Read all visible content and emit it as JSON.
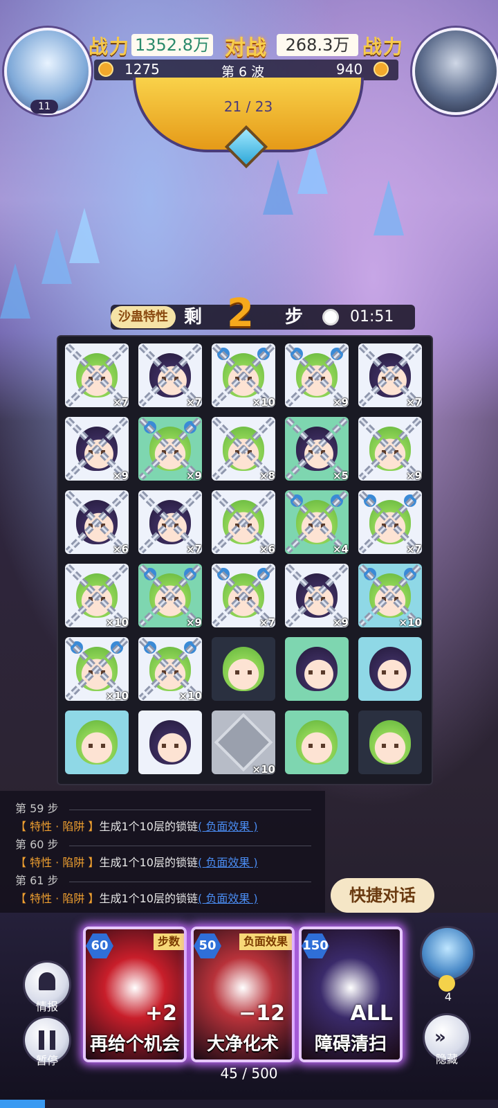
{
  "header": {
    "left_power_label": "战力",
    "left_power": "1352.8万",
    "vs_label": "对战",
    "right_power": "268.3万",
    "right_power_label": "战力",
    "left_score": "1275",
    "wave": "第 6 波",
    "right_score": "940",
    "left_level": "11",
    "wave_progress": "21 / 23"
  },
  "status": {
    "trait_label": "沙蛊特性",
    "steps_prefix": "剩",
    "steps_left": "2",
    "steps_suffix": "步",
    "timer": "01:51"
  },
  "board": {
    "rows": [
      [
        {
          "face": "green",
          "bg": "white",
          "chain": "×7"
        },
        {
          "face": "purple",
          "bg": "white",
          "chain": "×7"
        },
        {
          "face": "blue",
          "bg": "white",
          "chain": "×10"
        },
        {
          "face": "blue",
          "bg": "white",
          "chain": "×9"
        },
        {
          "face": "purple",
          "bg": "white",
          "chain": "×7"
        }
      ],
      [
        {
          "face": "purple",
          "bg": "white",
          "chain": "×9"
        },
        {
          "face": "blue",
          "bg": "green",
          "chain": "×9"
        },
        {
          "face": "green",
          "bg": "white",
          "chain": "×8"
        },
        {
          "face": "purple",
          "bg": "green",
          "chain": "×5"
        },
        {
          "face": "green",
          "bg": "white",
          "chain": "×9"
        }
      ],
      [
        {
          "face": "purple",
          "bg": "white",
          "chain": "×6"
        },
        {
          "face": "purple",
          "bg": "white",
          "chain": "×7"
        },
        {
          "face": "green",
          "bg": "white",
          "chain": "×6"
        },
        {
          "face": "blue",
          "bg": "green",
          "chain": "×4"
        },
        {
          "face": "blue",
          "bg": "white",
          "chain": "×7"
        }
      ],
      [
        {
          "face": "green",
          "bg": "white",
          "chain": "×10"
        },
        {
          "face": "blue",
          "bg": "green",
          "chain": "×9"
        },
        {
          "face": "blue",
          "bg": "white",
          "chain": "×7"
        },
        {
          "face": "purple",
          "bg": "white",
          "chain": "×9"
        },
        {
          "face": "blue",
          "bg": "cyan",
          "chain": "×10"
        }
      ],
      [
        {
          "face": "blue",
          "bg": "white",
          "chain": "×10"
        },
        {
          "face": "blue",
          "bg": "white",
          "chain": "×10"
        },
        {
          "face": "green",
          "bg": "dark",
          "chain": ""
        },
        {
          "face": "purple",
          "bg": "green",
          "chain": ""
        },
        {
          "face": "purple",
          "bg": "cyan",
          "chain": ""
        }
      ],
      [
        {
          "face": "green",
          "bg": "cyan",
          "chain": ""
        },
        {
          "face": "purple",
          "bg": "white",
          "chain": ""
        },
        {
          "face": "stone",
          "bg": "grey",
          "chain": "×10"
        },
        {
          "face": "green",
          "bg": "green",
          "chain": ""
        },
        {
          "face": "green",
          "bg": "dark",
          "chain": ""
        }
      ]
    ]
  },
  "log": {
    "step_59": "第 59 步",
    "entry_59_tag": "【 特性 · 陷阱 】",
    "entry_59_text": "生成1个10层的锁链",
    "entry_59_link": "( 负面效果 )",
    "step_60": "第 60 步",
    "entry_60_tag": "【 特性 · 陷阱 】",
    "entry_60_text": "生成1个10层的锁链",
    "entry_60_link": "( 负面效果 )",
    "step_61": "第 61 步",
    "entry_61_tag": "【 特性 · 陷阱 】",
    "entry_61_text": "生成1个10层的锁链",
    "entry_61_link": "( 负面效果 )"
  },
  "quick_chat": "快捷对话",
  "cards": [
    {
      "cost": "60",
      "tag": "步数",
      "name": "再给个机会",
      "effect": "+2",
      "art_color": "#c81e2a"
    },
    {
      "cost": "50",
      "tag": "负面效果",
      "name": "大净化术",
      "effect": "−12",
      "art_color": "#b8323a"
    },
    {
      "cost": "150",
      "tag": "",
      "name": "障碍清扫",
      "effect": "ALL",
      "art_color": "#3a2a6a"
    }
  ],
  "side": {
    "info_label": "情报",
    "pause_label": "暂停",
    "hide_label": "隐藏",
    "hero_charges": "4"
  },
  "energy": {
    "text": "45 / 500",
    "fraction": 0.09
  },
  "colors": {
    "accent_gold": "#f6c94c",
    "panel_dark": "#1a1a24",
    "card_glow": "#c56cff",
    "link_blue": "#4a8cf2",
    "tag_orange": "#f0a030"
  }
}
